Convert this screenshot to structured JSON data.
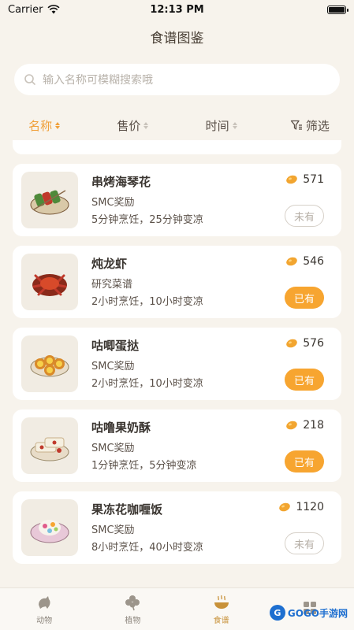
{
  "status": {
    "carrier": "Carrier",
    "time": "12:13 PM"
  },
  "header": {
    "title": "食谱图鉴"
  },
  "search": {
    "placeholder": "输入名称可模糊搜索哦"
  },
  "sort_bar": {
    "name_label": "名称",
    "price_label": "售价",
    "time_label": "时间",
    "filter_label": "筛选"
  },
  "recipes": [
    {
      "name": "串烤海琴花",
      "source": "SMC奖励",
      "times": "5分钟烹饪，25分钟变凉",
      "price": "571",
      "status": "未有",
      "owned": false
    },
    {
      "name": "炖龙虾",
      "source": "研究菜谱",
      "times": "2小时烹饪，10小时变凉",
      "price": "546",
      "status": "已有",
      "owned": true
    },
    {
      "name": "咕唧蛋挞",
      "source": "SMC奖励",
      "times": "2小时烹饪，10小时变凉",
      "price": "576",
      "status": "已有",
      "owned": true
    },
    {
      "name": "咕噜果奶酥",
      "source": "SMC奖励",
      "times": "1分钟烹饪，5分钟变凉",
      "price": "218",
      "status": "已有",
      "owned": true
    },
    {
      "name": "果冻花咖喱饭",
      "source": "SMC奖励",
      "times": "8小时烹饪，40小时变凉",
      "price": "1120",
      "status": "未有",
      "owned": false
    }
  ],
  "tabbar": {
    "tabs": [
      {
        "label": "动物",
        "icon": "animal-icon"
      },
      {
        "label": "植物",
        "icon": "clover-icon"
      },
      {
        "label": "食谱",
        "icon": "bowl-icon"
      },
      {
        "label": "",
        "icon": "grid-icon"
      }
    ]
  },
  "watermark": {
    "text": "GOGO手游网"
  },
  "colors": {
    "accent": "#f0a03a",
    "owned_button": "#f7a530",
    "background": "#f7f3ec"
  }
}
